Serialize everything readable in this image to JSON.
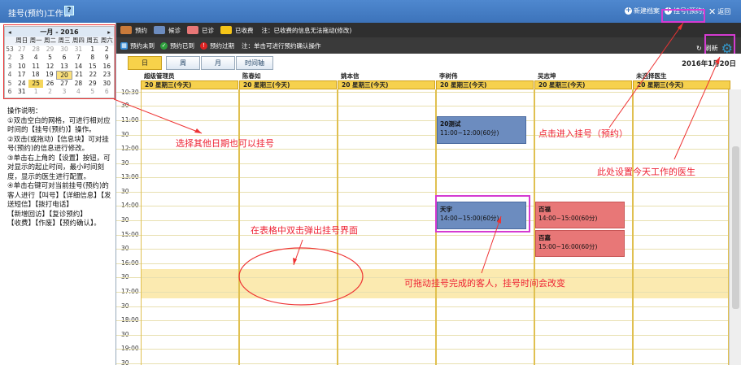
{
  "window": {
    "title": "挂号(预约)工作台",
    "help": "?"
  },
  "toolbar": {
    "new_record": "新建档案",
    "register": "挂号(预约)",
    "back": "返回"
  },
  "calendar": {
    "prev": "◂",
    "next": "▸",
    "title": "一月 - 2016",
    "weekdays": [
      "周日",
      "周一",
      "周二",
      "周三",
      "周四",
      "周五",
      "周六"
    ],
    "rows": [
      {
        "wk": "53",
        "days": [
          "27",
          "28",
          "29",
          "30",
          "31",
          "1",
          "2"
        ]
      },
      {
        "wk": "2",
        "days": [
          "3",
          "4",
          "5",
          "6",
          "7",
          "8",
          "9"
        ]
      },
      {
        "wk": "3",
        "days": [
          "10",
          "11",
          "12",
          "13",
          "14",
          "15",
          "16"
        ]
      },
      {
        "wk": "4",
        "days": [
          "17",
          "18",
          "19",
          "20",
          "21",
          "22",
          "23"
        ]
      },
      {
        "wk": "5",
        "days": [
          "24",
          "25",
          "26",
          "27",
          "28",
          "29",
          "30"
        ]
      },
      {
        "wk": "6",
        "days": [
          "31",
          "1",
          "2",
          "3",
          "4",
          "5",
          "6"
        ]
      }
    ]
  },
  "instructions": [
    "操作说明：",
    "①双击空白的网格，可进行相对应时间的【挂号(预约)】操作。",
    "②双击(或拖动)【信息块】可对挂号(预约)的信息进行修改。",
    "③单击右上角的【设置】按钮，可对显示的起止时间，最小时间刻度，显示的医生进行配置。",
    "④单击右键可对当前挂号(预约)的客人进行【叫号】【详细信息】【发送短信】【拨打电话】",
    "【新增回访】【复诊预约】",
    "【收费】【作废】【预约确认】。"
  ],
  "legend": [
    {
      "label": "预约",
      "color": "#c97a3a"
    },
    {
      "label": "候诊",
      "color": "#6c8cbf"
    },
    {
      "label": "已诊",
      "color": "#e87777"
    },
    {
      "label": "已收费",
      "color": "#f5c518"
    }
  ],
  "legend_note": "注：已收费的信息无法拖动(修改)",
  "status_bar": {
    "not_arrived": "预约未到",
    "arrived": "预约已到",
    "expired": "预约过期",
    "note": "注：单击可进行预约确认操作"
  },
  "refresh": "刷新",
  "views": [
    "日",
    "周",
    "月",
    "时间轴"
  ],
  "date_label": "2016年1月20日",
  "doctors": [
    {
      "name": "超级管理员",
      "date": "20 星期三(今天)"
    },
    {
      "name": "陈春如",
      "date": "20 星期三(今天)"
    },
    {
      "name": "姚本信",
      "date": "20 星期三(今天)"
    },
    {
      "name": "李树伟",
      "date": "20 星期三(今天)"
    },
    {
      "name": "吴志坤",
      "date": "20 星期三(今天)"
    },
    {
      "name": "未选择医生",
      "date": "20 星期三(今天)"
    }
  ],
  "times": [
    "10:30",
    "30",
    "11:00",
    "30",
    "12:00",
    "30",
    "13:00",
    "30",
    "14:00",
    "30",
    "15:00",
    "30",
    "16:00",
    "30",
    "17:00",
    "30",
    "18:00",
    "30",
    "19:00",
    "30"
  ],
  "appointments": [
    {
      "title": "20测试",
      "time": "11:00~12:00(60分)"
    },
    {
      "title": "天宇",
      "time": "14:00~15:00(60分)"
    },
    {
      "title": "百福",
      "time": "14:00~15:00(60分)"
    },
    {
      "title": "百嘉",
      "time": "15:00~16:00(60分)"
    }
  ],
  "annotations": {
    "other_date": "选择其他日期也可以挂号",
    "click_register": "点击进入挂号（预约）",
    "set_doctors": "此处设置今天工作的医生",
    "dblclick_grid": "在表格中双击弹出挂号界面",
    "drag_appt": "可拖动挂号完成的客人，挂号时间会改变"
  }
}
